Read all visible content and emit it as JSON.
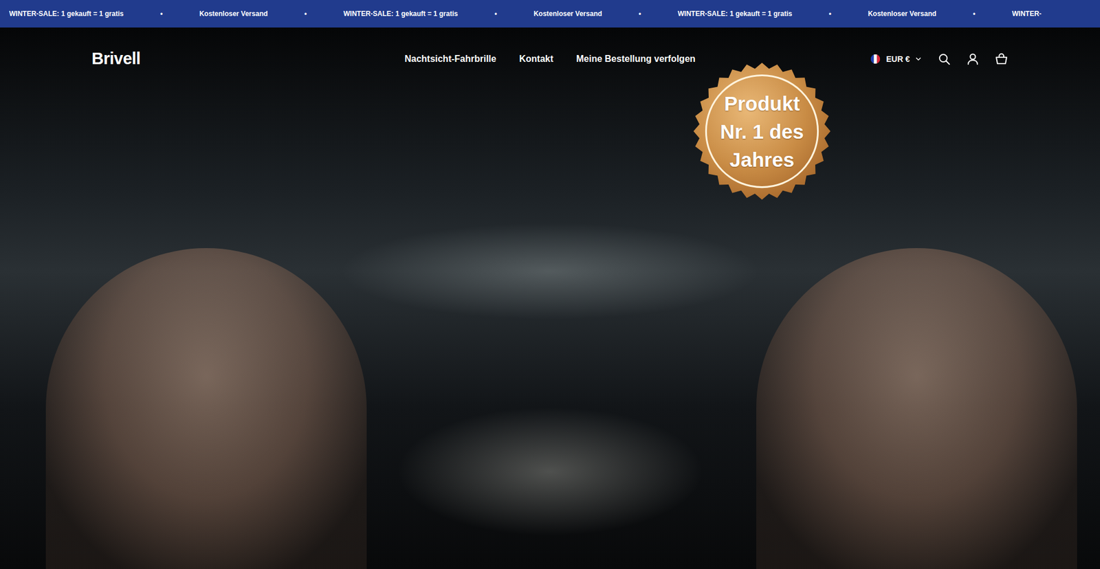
{
  "announcement": {
    "items": [
      "WINTER-SALE: 1 gekauft = 1 gratis",
      "•",
      "Kostenloser Versand",
      "•",
      "WINTER-SALE: 1 gekauft = 1 gratis",
      "•",
      "Kostenloser Versand",
      "•",
      "WINTER-SALE: 1 gekauft = 1 gratis",
      "•",
      "Kostenloser Versand",
      "•",
      "WINTER-"
    ]
  },
  "header": {
    "logo": "Brivell",
    "nav": [
      {
        "label": "Nachtsicht-Fahrbrille"
      },
      {
        "label": "Kontakt"
      },
      {
        "label": "Meine Bestellung verfolgen"
      }
    ],
    "currency": "EUR €"
  },
  "hero": {
    "badge": [
      "Produkt",
      "Nr. 1 des",
      "Jahres"
    ]
  }
}
